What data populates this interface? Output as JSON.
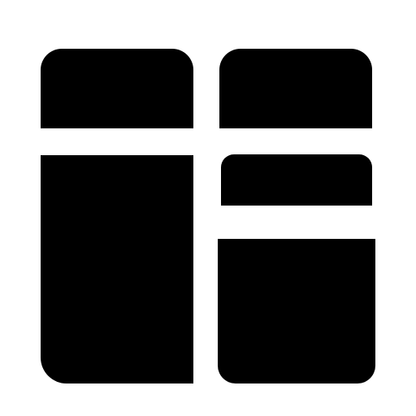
{
  "icon": {
    "name": "dashboard-layout-icon",
    "color": "#000000",
    "background": "#ffffff"
  }
}
